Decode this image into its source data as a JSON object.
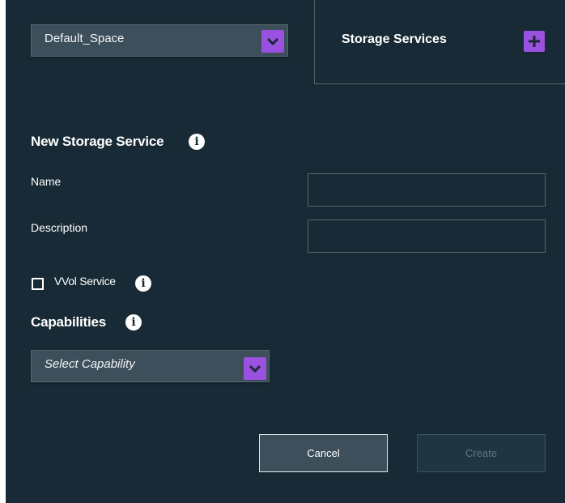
{
  "space_selector": {
    "value": "Default_Space",
    "icon": "chevron-down-icon"
  },
  "storage_services": {
    "title": "Storage Services",
    "add_icon": "plus-icon"
  },
  "form": {
    "title": "New Storage Service",
    "name_label": "Name",
    "name_value": "",
    "description_label": "Description",
    "description_value": "",
    "vvol_label": "VVol Service",
    "vvol_checked": false,
    "capabilities_title": "Capabilities",
    "capability_select": "Select Capability"
  },
  "actions": {
    "cancel": "Cancel",
    "create": "Create"
  },
  "colors": {
    "background": "#172a35",
    "accent": "#9b51e0",
    "control": "#3c4f5b"
  }
}
